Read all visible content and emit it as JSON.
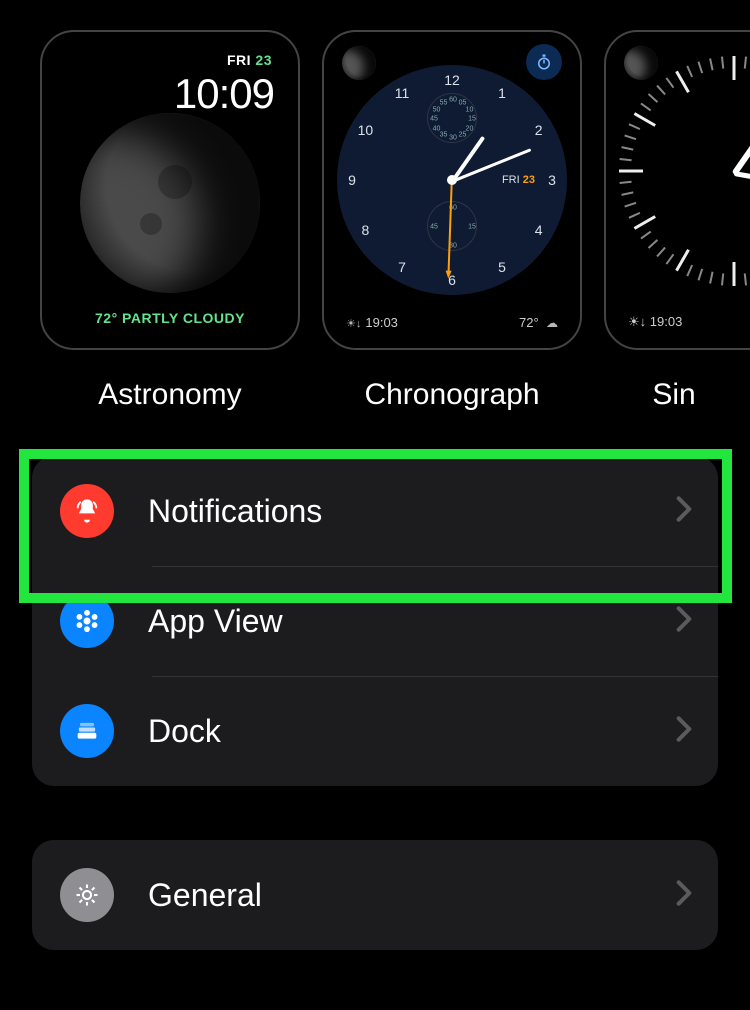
{
  "faces": [
    {
      "name": "Astronomy",
      "weekday": "FRI",
      "daynum": "23",
      "time": "10:09",
      "weather": "72° PARTLY CLOUDY"
    },
    {
      "name": "Chronograph",
      "day_label": "FRI",
      "day_num": "23",
      "sunset": "19:03",
      "temp": "72°",
      "hours": [
        "12",
        "1",
        "2",
        "3",
        "4",
        "5",
        "6",
        "7",
        "8",
        "9",
        "10",
        "11"
      ],
      "sub_top": [
        "60",
        "05",
        "10",
        "15",
        "20",
        "25",
        "30",
        "35",
        "40",
        "45",
        "50",
        "55"
      ],
      "sub_bot": [
        "60",
        "15",
        "30",
        "45"
      ]
    },
    {
      "name": "Simple",
      "sunset": "19:03"
    }
  ],
  "menu1": [
    {
      "label": "Notifications",
      "icon": "bell",
      "color": "ic-red"
    },
    {
      "label": "App View",
      "icon": "apps",
      "color": "ic-blue"
    },
    {
      "label": "Dock",
      "icon": "dock",
      "color": "ic-blue"
    }
  ],
  "menu2": [
    {
      "label": "General",
      "icon": "gear",
      "color": "ic-gray"
    }
  ]
}
